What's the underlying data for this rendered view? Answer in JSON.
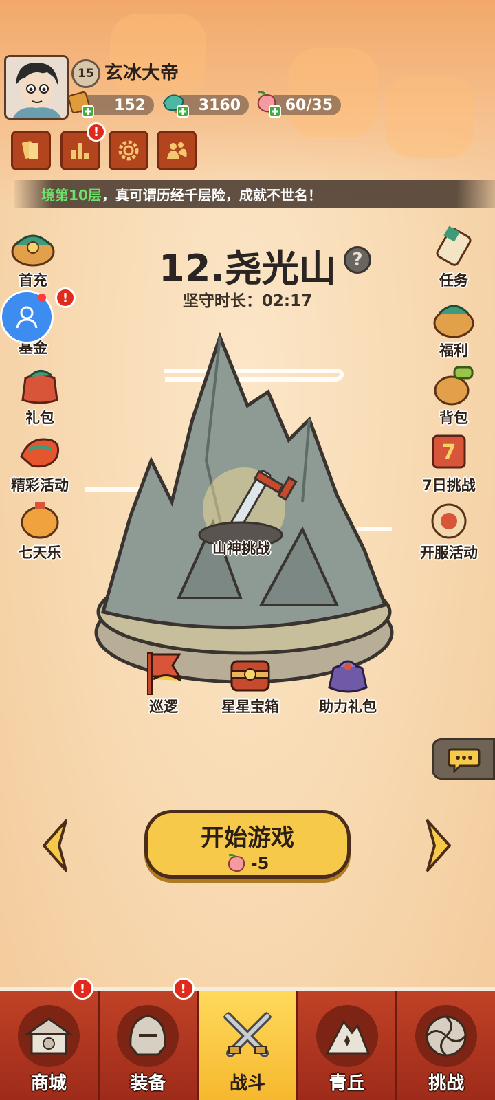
{
  "player": {
    "level": "15",
    "name": "玄冰大帝"
  },
  "resources": {
    "tickets": "152",
    "jade": "3160",
    "stamina": "60/35"
  },
  "banner": {
    "highlight": "境第10层",
    "text": "，真可谓历经千层险，成就不世名！"
  },
  "left_menu": [
    {
      "label": "首充"
    },
    {
      "label": "基金"
    },
    {
      "label": "礼包"
    },
    {
      "label": "精彩活动"
    },
    {
      "label": "七天乐"
    }
  ],
  "right_menu": [
    {
      "label": "任务"
    },
    {
      "label": "福利"
    },
    {
      "label": "背包"
    },
    {
      "label": "7日挑战"
    },
    {
      "label": "开服活动"
    }
  ],
  "stage": {
    "title": "12.尧光山",
    "help": "?",
    "duration_label": "坚守时长：",
    "duration_value": "02:17",
    "boss_label": "山神挑战"
  },
  "bottom_actions": [
    {
      "label": "巡逻"
    },
    {
      "label": "星星宝箱"
    },
    {
      "label": "助力礼包"
    }
  ],
  "start": {
    "label": "开始游戏",
    "cost": "-5"
  },
  "tabs": [
    {
      "label": "商城",
      "alert": "!"
    },
    {
      "label": "装备",
      "alert": "!"
    },
    {
      "label": "战斗"
    },
    {
      "label": "青丘"
    },
    {
      "label": "挑战"
    }
  ],
  "alerts": {
    "menu_button": "!",
    "fund": "!"
  },
  "colors": {
    "accent": "#f6c94a",
    "tabbar": "#9e2b1a",
    "alert": "#e02a1b"
  }
}
